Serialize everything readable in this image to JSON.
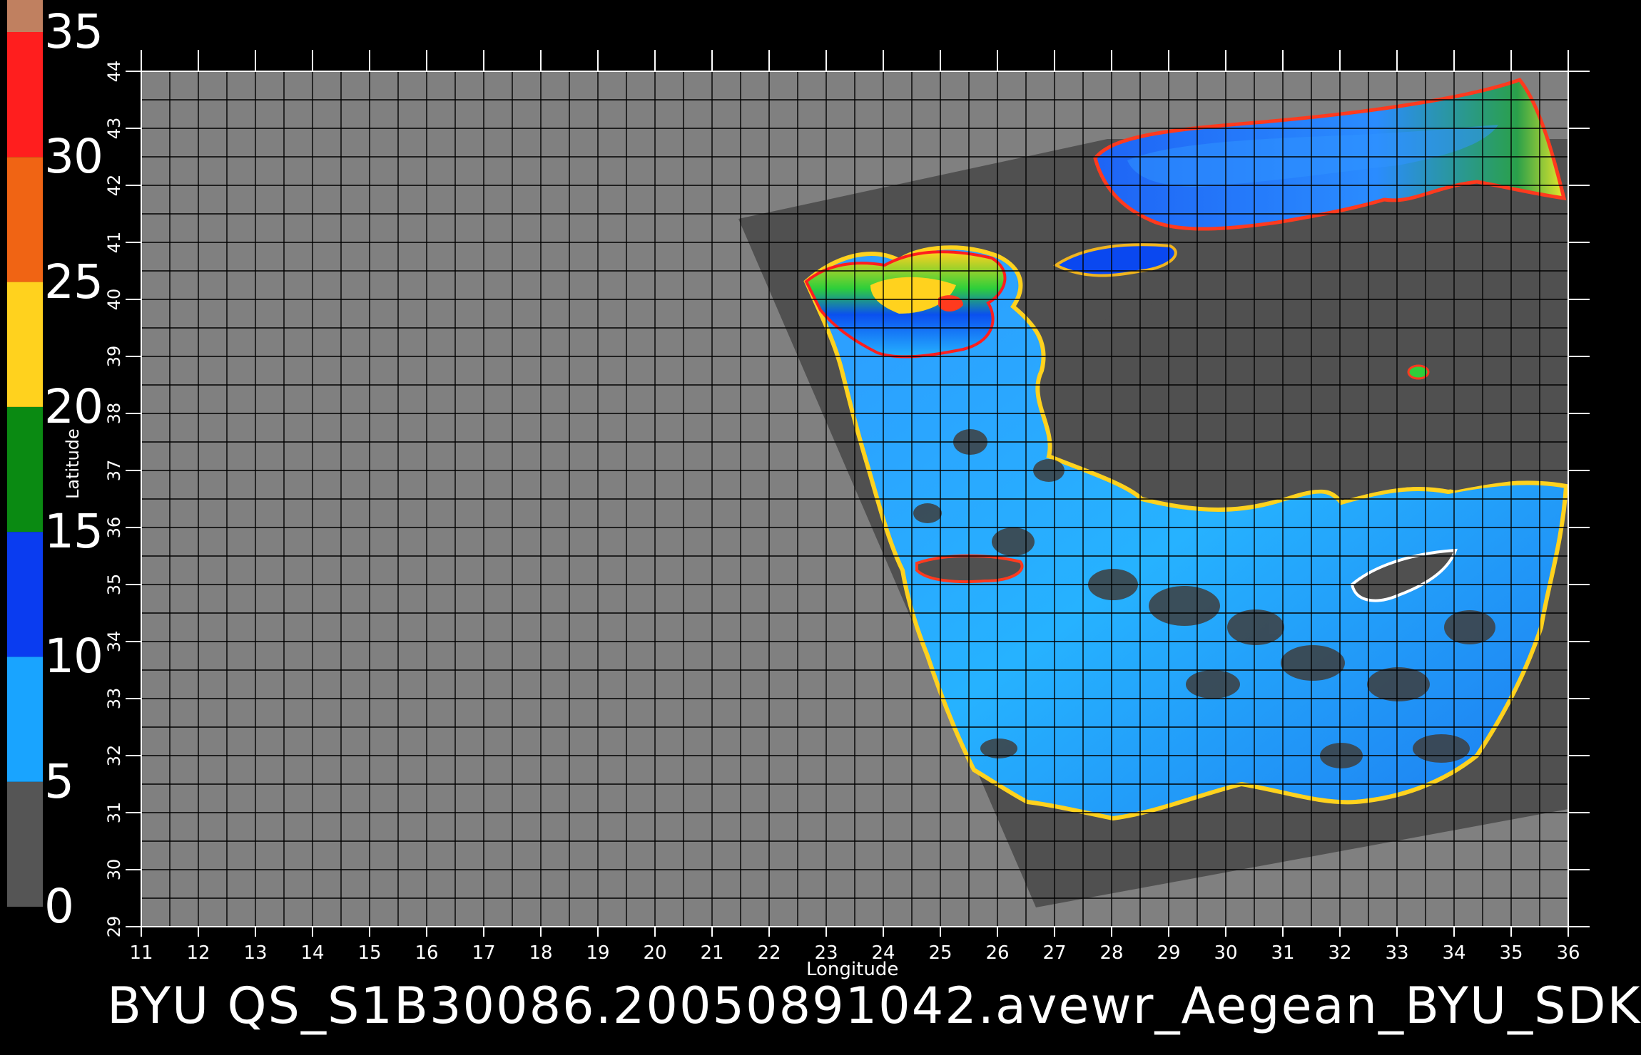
{
  "colorbar": {
    "labels": [
      "35",
      "30",
      "25",
      "20",
      "15",
      "10",
      "5",
      "0"
    ],
    "segments": [
      {
        "from": 0,
        "to": 5,
        "color": "#555555"
      },
      {
        "from": 5,
        "to": 10,
        "color": "#19a4ff"
      },
      {
        "from": 10,
        "to": 15,
        "color": "#0a3cf0"
      },
      {
        "from": 15,
        "to": 20,
        "color": "#0a8a12"
      },
      {
        "from": 20,
        "to": 25,
        "color": "#ffd21e"
      },
      {
        "from": 25,
        "to": 30,
        "color": "#f06414"
      },
      {
        "from": 30,
        "to": 35,
        "color": "#ff1e1e"
      }
    ],
    "top_cap_color": "#c08060"
  },
  "map": {
    "background_color": "#808080",
    "swath_color": "#505050",
    "longitude_ticks": [
      "11",
      "12",
      "13",
      "14",
      "15",
      "16",
      "17",
      "18",
      "19",
      "20",
      "21",
      "22",
      "23",
      "24",
      "25",
      "26",
      "27",
      "28",
      "29",
      "30",
      "31",
      "32",
      "33",
      "34",
      "35",
      "36"
    ],
    "latitude_ticks": [
      "29",
      "30",
      "31",
      "32",
      "33",
      "34",
      "35",
      "36",
      "37",
      "38",
      "39",
      "40",
      "41",
      "42",
      "43",
      "44"
    ],
    "lon_range": [
      11,
      36
    ],
    "lat_range": [
      29,
      44
    ],
    "xlabel": "Longitude",
    "ylabel": "Latitude"
  },
  "title": "BYU  QS_S1B30086.20050891042.avewr_Aegean_BYU_SDK"
}
